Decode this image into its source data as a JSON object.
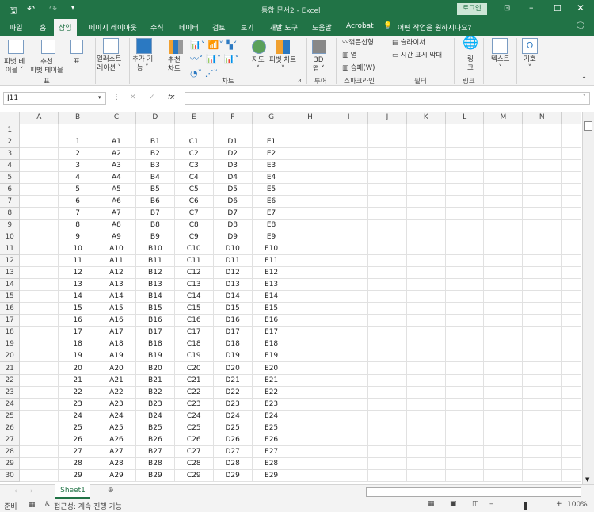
{
  "app": {
    "title": "통합 문서2  -  Excel",
    "login": "로그인"
  },
  "tabs": [
    "파일",
    "홈",
    "삽입",
    "페이지 레이아웃",
    "수식",
    "데이터",
    "검토",
    "보기",
    "개발 도구",
    "도움말",
    "Acrobat"
  ],
  "tell_me": "어떤 작업을 원하시나요?",
  "ribbon": {
    "pivot_table": "피벗 테\n이블 ˅",
    "recommended_pivot": "추천\n피벗 테이블",
    "table": "표",
    "illustrations": "일러스트\n레이션 ˅",
    "addins": "추가 기\n능 ˅",
    "recommended_charts": "추천\n차트",
    "maps": "지도\n˅",
    "pivot_chart": "피벗 차트\n˅",
    "map3d": "3D\n맵 ˅",
    "sparkline_line": "꺾은선형",
    "sparkline_column": "열",
    "sparkline_winloss": "승패(W)",
    "slicer": "슬라이서",
    "timeline": "시간 표시 막대",
    "link": "링\n크",
    "text": "텍스트\n˅",
    "symbol": "기호\n˅",
    "groups": {
      "tables": "표",
      "charts": "차트",
      "tours": "투어",
      "sparklines": "스파크라인",
      "filters": "필터",
      "links": "링크"
    }
  },
  "formula_bar": {
    "name_box": "J11",
    "fx": "fx",
    "value": ""
  },
  "columns": [
    "A",
    "B",
    "C",
    "D",
    "E",
    "F",
    "G",
    "H",
    "I",
    "J",
    "K",
    "L",
    "M",
    "N"
  ],
  "row_count": 30,
  "cells_prefix": [
    "",
    "A",
    "B",
    "C",
    "D",
    "E"
  ],
  "sheet": {
    "tab": "Sheet1"
  },
  "status": {
    "ready": "준비",
    "accessibility": "접근성: 계속 진행 가능",
    "zoom": "100%",
    "zoom_level": 100
  }
}
